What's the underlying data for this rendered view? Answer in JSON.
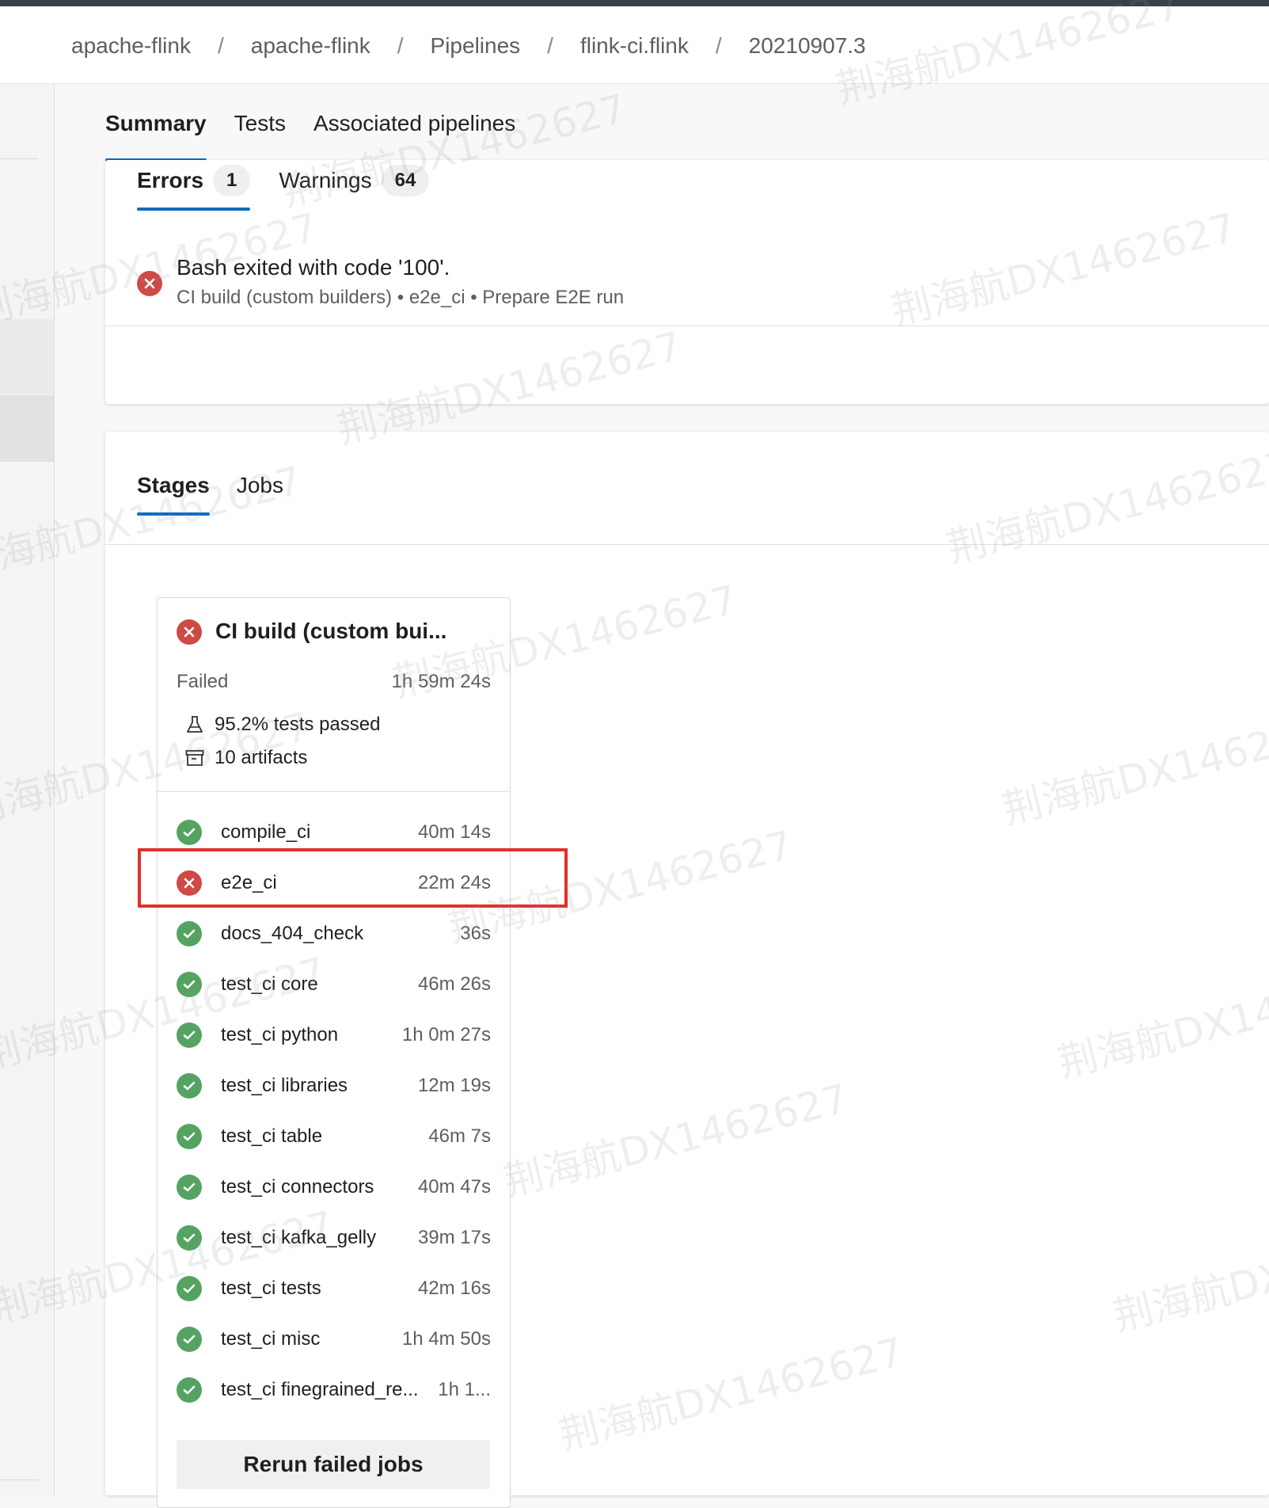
{
  "breadcrumb": [
    {
      "label": "apache-flink"
    },
    {
      "label": "apache-flink"
    },
    {
      "label": "Pipelines"
    },
    {
      "label": "flink-ci.flink"
    },
    {
      "label": "20210907.3"
    }
  ],
  "breadcrumb_separator": "/",
  "main_tabs": [
    {
      "label": "Summary",
      "active": true
    },
    {
      "label": "Tests",
      "active": false
    },
    {
      "label": "Associated pipelines",
      "active": false
    }
  ],
  "issues": {
    "tabs": [
      {
        "label": "Errors",
        "count": "1",
        "active": true
      },
      {
        "label": "Warnings",
        "count": "64",
        "active": false
      }
    ],
    "error": {
      "title": "Bash exited with code '100'.",
      "subtitle": "CI build (custom builders) • e2e_ci • Prepare E2E run"
    }
  },
  "stages": {
    "tabs": [
      {
        "label": "Stages",
        "active": true
      },
      {
        "label": "Jobs",
        "active": false
      }
    ],
    "card": {
      "title": "CI build (custom bui...",
      "status": "Failed",
      "duration": "1h 59m 24s",
      "tests_passed": "95.2% tests passed",
      "artifacts": "10 artifacts",
      "jobs": [
        {
          "name": "compile_ci",
          "time": "40m 14s",
          "status": "success"
        },
        {
          "name": "e2e_ci",
          "time": "22m 24s",
          "status": "failed"
        },
        {
          "name": "docs_404_check",
          "time": "36s",
          "status": "success"
        },
        {
          "name": "test_ci core",
          "time": "46m 26s",
          "status": "success"
        },
        {
          "name": "test_ci python",
          "time": "1h 0m 27s",
          "status": "success"
        },
        {
          "name": "test_ci libraries",
          "time": "12m 19s",
          "status": "success"
        },
        {
          "name": "test_ci table",
          "time": "46m 7s",
          "status": "success"
        },
        {
          "name": "test_ci connectors",
          "time": "40m 47s",
          "status": "success"
        },
        {
          "name": "test_ci kafka_gelly",
          "time": "39m 17s",
          "status": "success"
        },
        {
          "name": "test_ci tests",
          "time": "42m 16s",
          "status": "success"
        },
        {
          "name": "test_ci misc",
          "time": "1h 4m 50s",
          "status": "success"
        },
        {
          "name": "test_ci finegrained_re...",
          "time": "1h 1...",
          "status": "success"
        }
      ],
      "rerun_label": "Rerun failed jobs"
    }
  },
  "watermark": "荆海航DX1462627",
  "colors": {
    "accent": "#0f6cbd",
    "error": "#cd4a45",
    "success": "#55a362",
    "highlight": "#e0302b"
  },
  "icons": {
    "error": "x-circle-icon",
    "success": "check-circle-icon",
    "tests": "flask-icon",
    "artifacts": "archive-icon"
  }
}
